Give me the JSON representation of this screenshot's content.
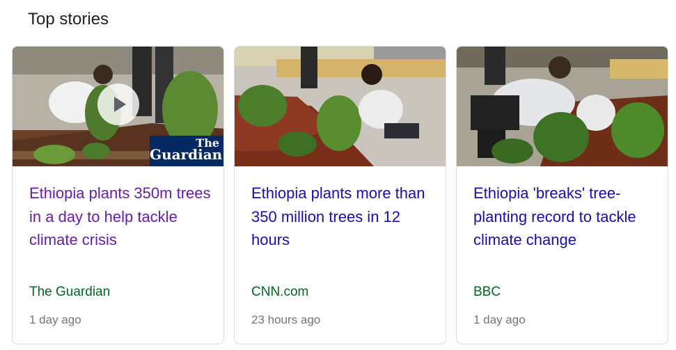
{
  "section": {
    "title": "Top stories"
  },
  "stories": [
    {
      "headline": "Ethiopia plants 350m trees in a day to help tackle climate crisis",
      "source": "The Guardian",
      "age": "1 day ago",
      "visited": true,
      "has_video": true,
      "logo_text": [
        "The",
        "Guardian"
      ]
    },
    {
      "headline": "Ethiopia plants more than 350 million trees in 12 hours",
      "source": "CNN.com",
      "age": "23 hours ago",
      "visited": false,
      "has_video": false
    },
    {
      "headline": "Ethiopia 'breaks' tree-planting record to tackle climate change",
      "source": "BBC",
      "age": "1 day ago",
      "visited": false,
      "has_video": false
    }
  ],
  "colors": {
    "visited_link": "#681da8",
    "link": "#1a0dab",
    "source": "#006621",
    "meta": "#70757a",
    "guardian_blue": "#052962"
  }
}
